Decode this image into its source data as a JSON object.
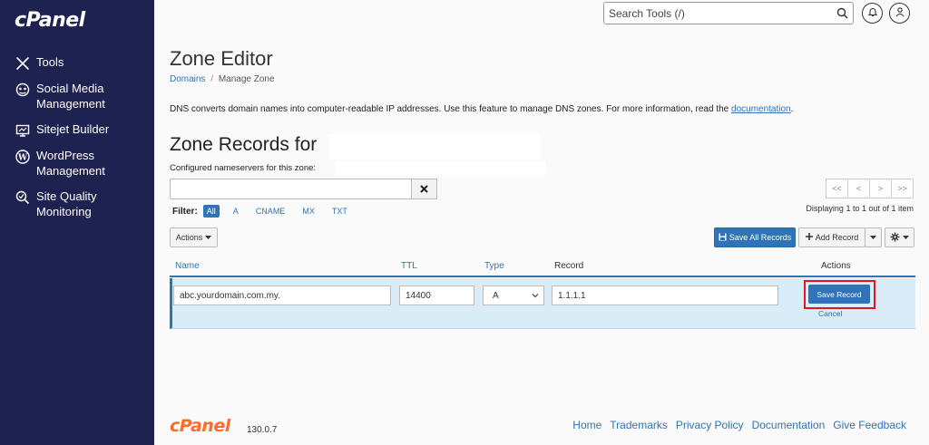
{
  "brand": {
    "logo": "cPanel"
  },
  "sidebar": {
    "items": [
      {
        "label": "Tools",
        "icon": "tools-icon"
      },
      {
        "label": "Social Media Management",
        "icon": "social-media-icon"
      },
      {
        "label": "Sitejet Builder",
        "icon": "sitejet-icon"
      },
      {
        "label": "WordPress Management",
        "icon": "wordpress-icon"
      },
      {
        "label": "Site Quality Monitoring",
        "icon": "site-quality-icon"
      }
    ]
  },
  "header": {
    "search_placeholder": "Search Tools (/)"
  },
  "page": {
    "title": "Zone Editor",
    "breadcrumb": {
      "parent": "Domains",
      "separator": "/",
      "current": "Manage Zone"
    },
    "description": "DNS converts domain names into computer-readable IP addresses. Use this feature to manage DNS zones. For more information, read the ",
    "description_link": "documentation",
    "description_end": "."
  },
  "zone": {
    "title": "Zone Records for",
    "nameservers_label": "Configured nameservers for this zone:"
  },
  "filter": {
    "label": "Filter:",
    "options": [
      "All",
      "A",
      "CNAME",
      "MX",
      "TXT"
    ],
    "active": "All"
  },
  "pager": {
    "buttons": [
      "<<",
      "<",
      ">",
      ">>"
    ],
    "displaying": "Displaying 1 to 1 out of 1 item"
  },
  "toolbar": {
    "actions": "Actions",
    "save_all": "Save All Records",
    "add_record": "Add Record"
  },
  "table": {
    "headers": {
      "name": "Name",
      "ttl": "TTL",
      "type": "Type",
      "record": "Record",
      "actions": "Actions"
    },
    "row": {
      "name": "abc.yourdomain.com.my.",
      "ttl": "14400",
      "type": "A",
      "record": "1.1.1.1",
      "save": "Save Record",
      "cancel": "Cancel"
    }
  },
  "footer": {
    "logo": "cPanel",
    "version": "130.0.7",
    "links": [
      "Home",
      "Trademarks",
      "Privacy Policy",
      "Documentation",
      "Give Feedback"
    ]
  },
  "colors": {
    "sidebar": "#1e2250",
    "accent": "#2f74b8",
    "highlight": "#e01818",
    "footer_logo": "#ff6c2c"
  }
}
